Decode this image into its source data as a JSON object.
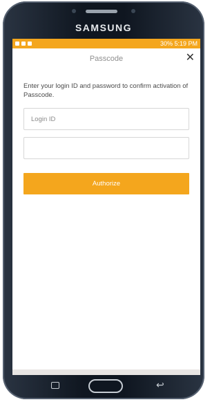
{
  "device": {
    "brand": "SAMSUNG"
  },
  "status_bar": {
    "text": "30% 5:19 PM"
  },
  "header": {
    "title": "Passcode",
    "close_glyph": "✕"
  },
  "instructions": "Enter your login ID and password to confirm activation of Passcode.",
  "form": {
    "login_placeholder": "Login ID",
    "password_placeholder": "",
    "authorize_label": "Authorize"
  },
  "colors": {
    "accent": "#f4a61d"
  },
  "icons": {
    "close": "close-icon",
    "home": "home-button",
    "recent_apps": "recent-apps-icon",
    "back": "back-icon"
  }
}
